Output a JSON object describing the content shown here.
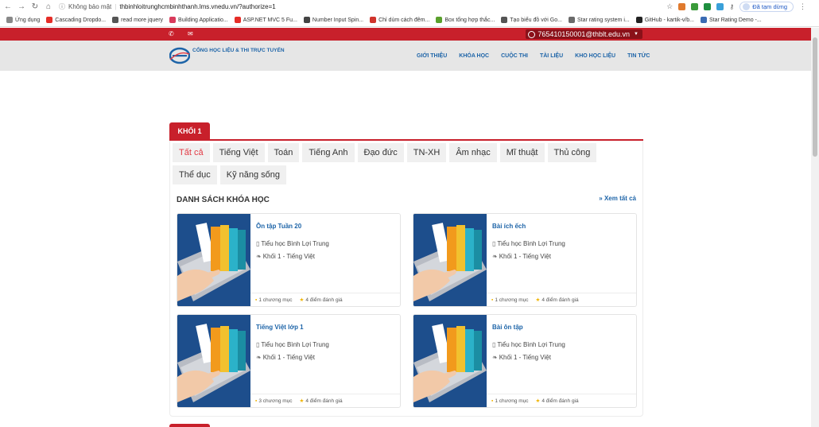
{
  "browser": {
    "security_label": "Không bảo mật",
    "url": "thbinhloitrunghcmbinhthanh.lms.vnedu.vn/?authorize=1",
    "paused_label": "Đã tạm dừng"
  },
  "bookmarks": [
    {
      "label": "Ứng dụng",
      "color": "#888888"
    },
    {
      "label": "Cascading Dropdo...",
      "color": "#e52d27"
    },
    {
      "label": "read more jquery",
      "color": "#555555"
    },
    {
      "label": "Building Applicatio...",
      "color": "#d93b5c"
    },
    {
      "label": "ASP.NET MVC 5 Fu...",
      "color": "#e52d27"
    },
    {
      "label": "Number Input Spin...",
      "color": "#444444"
    },
    {
      "label": "Chỉ dùm cách đêm...",
      "color": "#d0342c"
    },
    {
      "label": "Box tổng hợp thắc...",
      "color": "#5aa02c"
    },
    {
      "label": "Tạo biểu đồ với Go...",
      "color": "#555555"
    },
    {
      "label": "Star rating system i...",
      "color": "#6a6a6a"
    },
    {
      "label": "GitHub - kartik-v/b...",
      "color": "#222222"
    },
    {
      "label": "Star Rating Demo -...",
      "color": "#3b6cb4"
    }
  ],
  "topbar": {
    "account_email": "765410150001@thblt.edu.vn"
  },
  "header": {
    "logo_text": "CỔNG HỌC LIỆU & THI TRỰC TUYẾN",
    "nav": [
      "GIỚI THIỆU",
      "KHÓA HỌC",
      "CUỘC THI",
      "TÀI LIỆU",
      "KHO HỌC LIỆU",
      "TIN TỨC"
    ]
  },
  "section": {
    "tab_label": "KHỐI 1",
    "subjects": [
      {
        "label": "Tất cả",
        "active": true
      },
      {
        "label": "Tiếng Việt",
        "active": false
      },
      {
        "label": "Toán",
        "active": false
      },
      {
        "label": "Tiếng Anh",
        "active": false
      },
      {
        "label": "Đạo đức",
        "active": false
      },
      {
        "label": "TN-XH",
        "active": false
      },
      {
        "label": "Âm nhạc",
        "active": false
      },
      {
        "label": "Mĩ thuật",
        "active": false
      },
      {
        "label": "Thủ công",
        "active": false
      },
      {
        "label": "Thể dục",
        "active": false
      },
      {
        "label": "Kỹ năng sống",
        "active": false
      }
    ],
    "list_title": "DANH SÁCH KHÓA HỌC",
    "see_all": "» Xem tất cả",
    "courses": [
      {
        "title": "Ôn tập Tuần 20",
        "school": "Tiểu học Bình Lợi Trung",
        "grade": "Khối 1 - Tiếng Việt",
        "chapters": "1 chương mục",
        "rating": "4 điểm đánh giá"
      },
      {
        "title": "Bài ích ếch",
        "school": "Tiểu học Bình Lợi Trung",
        "grade": "Khối 1 - Tiếng Việt",
        "chapters": "1 chương mục",
        "rating": "4 điểm đánh giá"
      },
      {
        "title": "Tiếng Việt lớp 1",
        "school": "Tiểu học Bình Lợi Trung",
        "grade": "Khối 1 - Tiếng Việt",
        "chapters": "3 chương mục",
        "rating": "4 điểm đánh giá"
      },
      {
        "title": "Bài ôn tập",
        "school": "Tiểu học Bình Lợi Trung",
        "grade": "Khối 1 - Tiếng Việt",
        "chapters": "1 chương mục",
        "rating": "4 điểm đánh giá"
      }
    ]
  },
  "colors": {
    "brand_red": "#c8202b",
    "brand_blue": "#1d64a8",
    "active_subject": "#e23a44"
  }
}
